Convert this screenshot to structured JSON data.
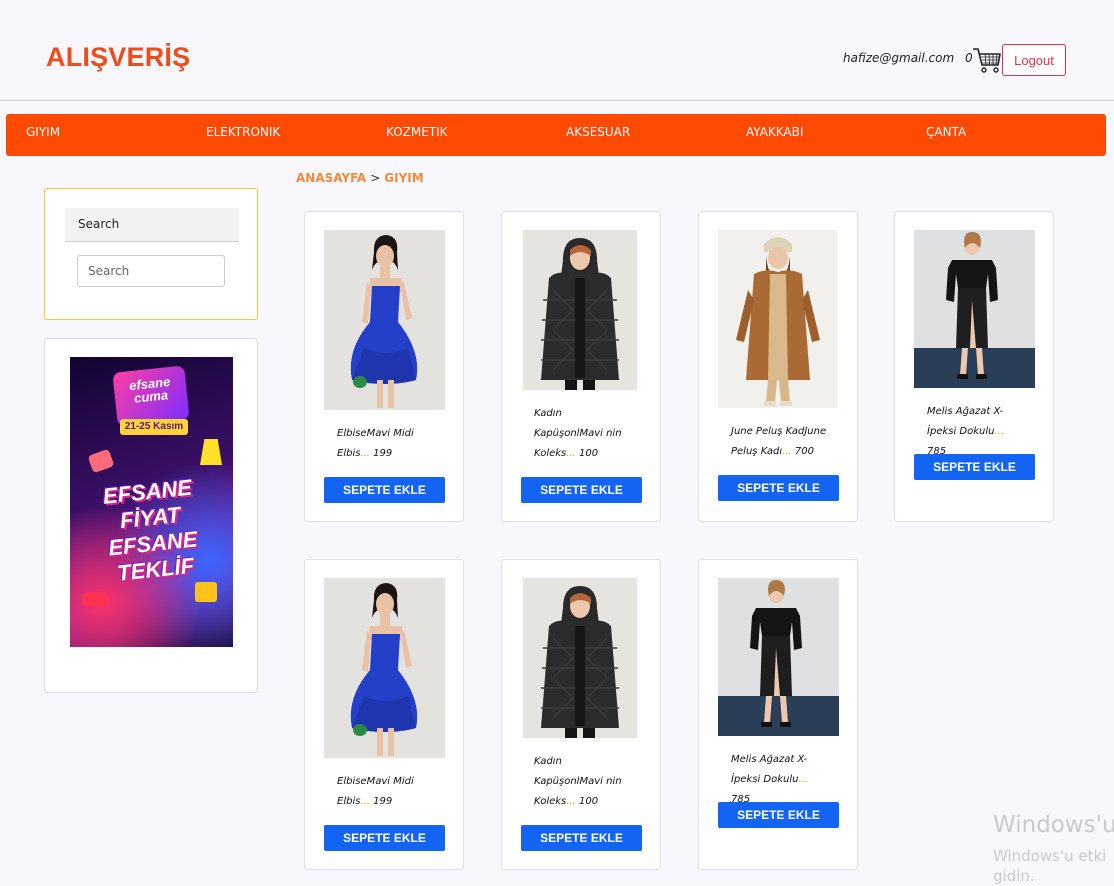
{
  "header": {
    "brand": "ALIŞVERİŞ",
    "user_email": "hafize@gmail.com",
    "cart_count": "0",
    "cart_icon": "shopping-cart-icon",
    "logout_label": "Logout"
  },
  "nav": {
    "items": [
      "GIYIM",
      "ELEKTRONIK",
      "KOZMETIK",
      "AKSESUAR",
      "AYAKKABI",
      "ÇANTA"
    ]
  },
  "breadcrumb": {
    "home": "ANASAYFA",
    "separator": ">",
    "current": "GIYIM"
  },
  "sidebar": {
    "search_title": "Search",
    "search_placeholder": "Search",
    "promo": {
      "badge_line1": "efsane",
      "badge_line2": "cuma",
      "date": "21-25 Kasım",
      "headline": "EFSANE FİYAT EFSANE TEKLİF"
    }
  },
  "products": [
    {
      "lines": [
        "ElbiseMavi Midi",
        "Elbis"
      ],
      "dots": "...",
      "price": "199",
      "image": "blue-dress",
      "button": "SEPETE EKLE"
    },
    {
      "lines": [
        "Kadın",
        "KapüşonlMavi nin",
        "Koleks"
      ],
      "dots": "...",
      "price": "100",
      "image": "black-puffer-coat",
      "button": "SEPETE EKLE"
    },
    {
      "lines": [
        "June Peluş KadJune",
        "Peluş Kadı"
      ],
      "dots": "...",
      "price": "700",
      "image": "brown-plush-coat",
      "button": "SEPETE EKLE"
    },
    {
      "lines": [
        "Melis Ağazat X-",
        "İpeksi Dokulu"
      ],
      "dots": "...",
      "price": "785",
      "image": "black-leather-skirt",
      "button": "SEPETE EKLE"
    },
    {
      "lines": [
        "ElbiseMavi Midi",
        "Elbis"
      ],
      "dots": "...",
      "price": "199",
      "image": "blue-dress",
      "button": "SEPETE EKLE"
    },
    {
      "lines": [
        "Kadın",
        "KapüşonlMavi nin",
        "Koleks"
      ],
      "dots": "...",
      "price": "100",
      "image": "black-puffer-coat",
      "button": "SEPETE EKLE"
    },
    {
      "lines": [
        "Melis Ağazat X-",
        "İpeksi Dokulu"
      ],
      "dots": "...",
      "price": "785",
      "image": "black-leather-skirt",
      "button": "SEPETE EKLE"
    }
  ],
  "watermark": {
    "line1": "Windows'u",
    "line2": "Windows'u etki",
    "line3": "gidin."
  },
  "colors": {
    "brand": "#ee4d1b",
    "nav": "#ff4a04",
    "button": "#1464f4",
    "breadcrumb": "#f08a3c",
    "logout": "#dc3545"
  }
}
